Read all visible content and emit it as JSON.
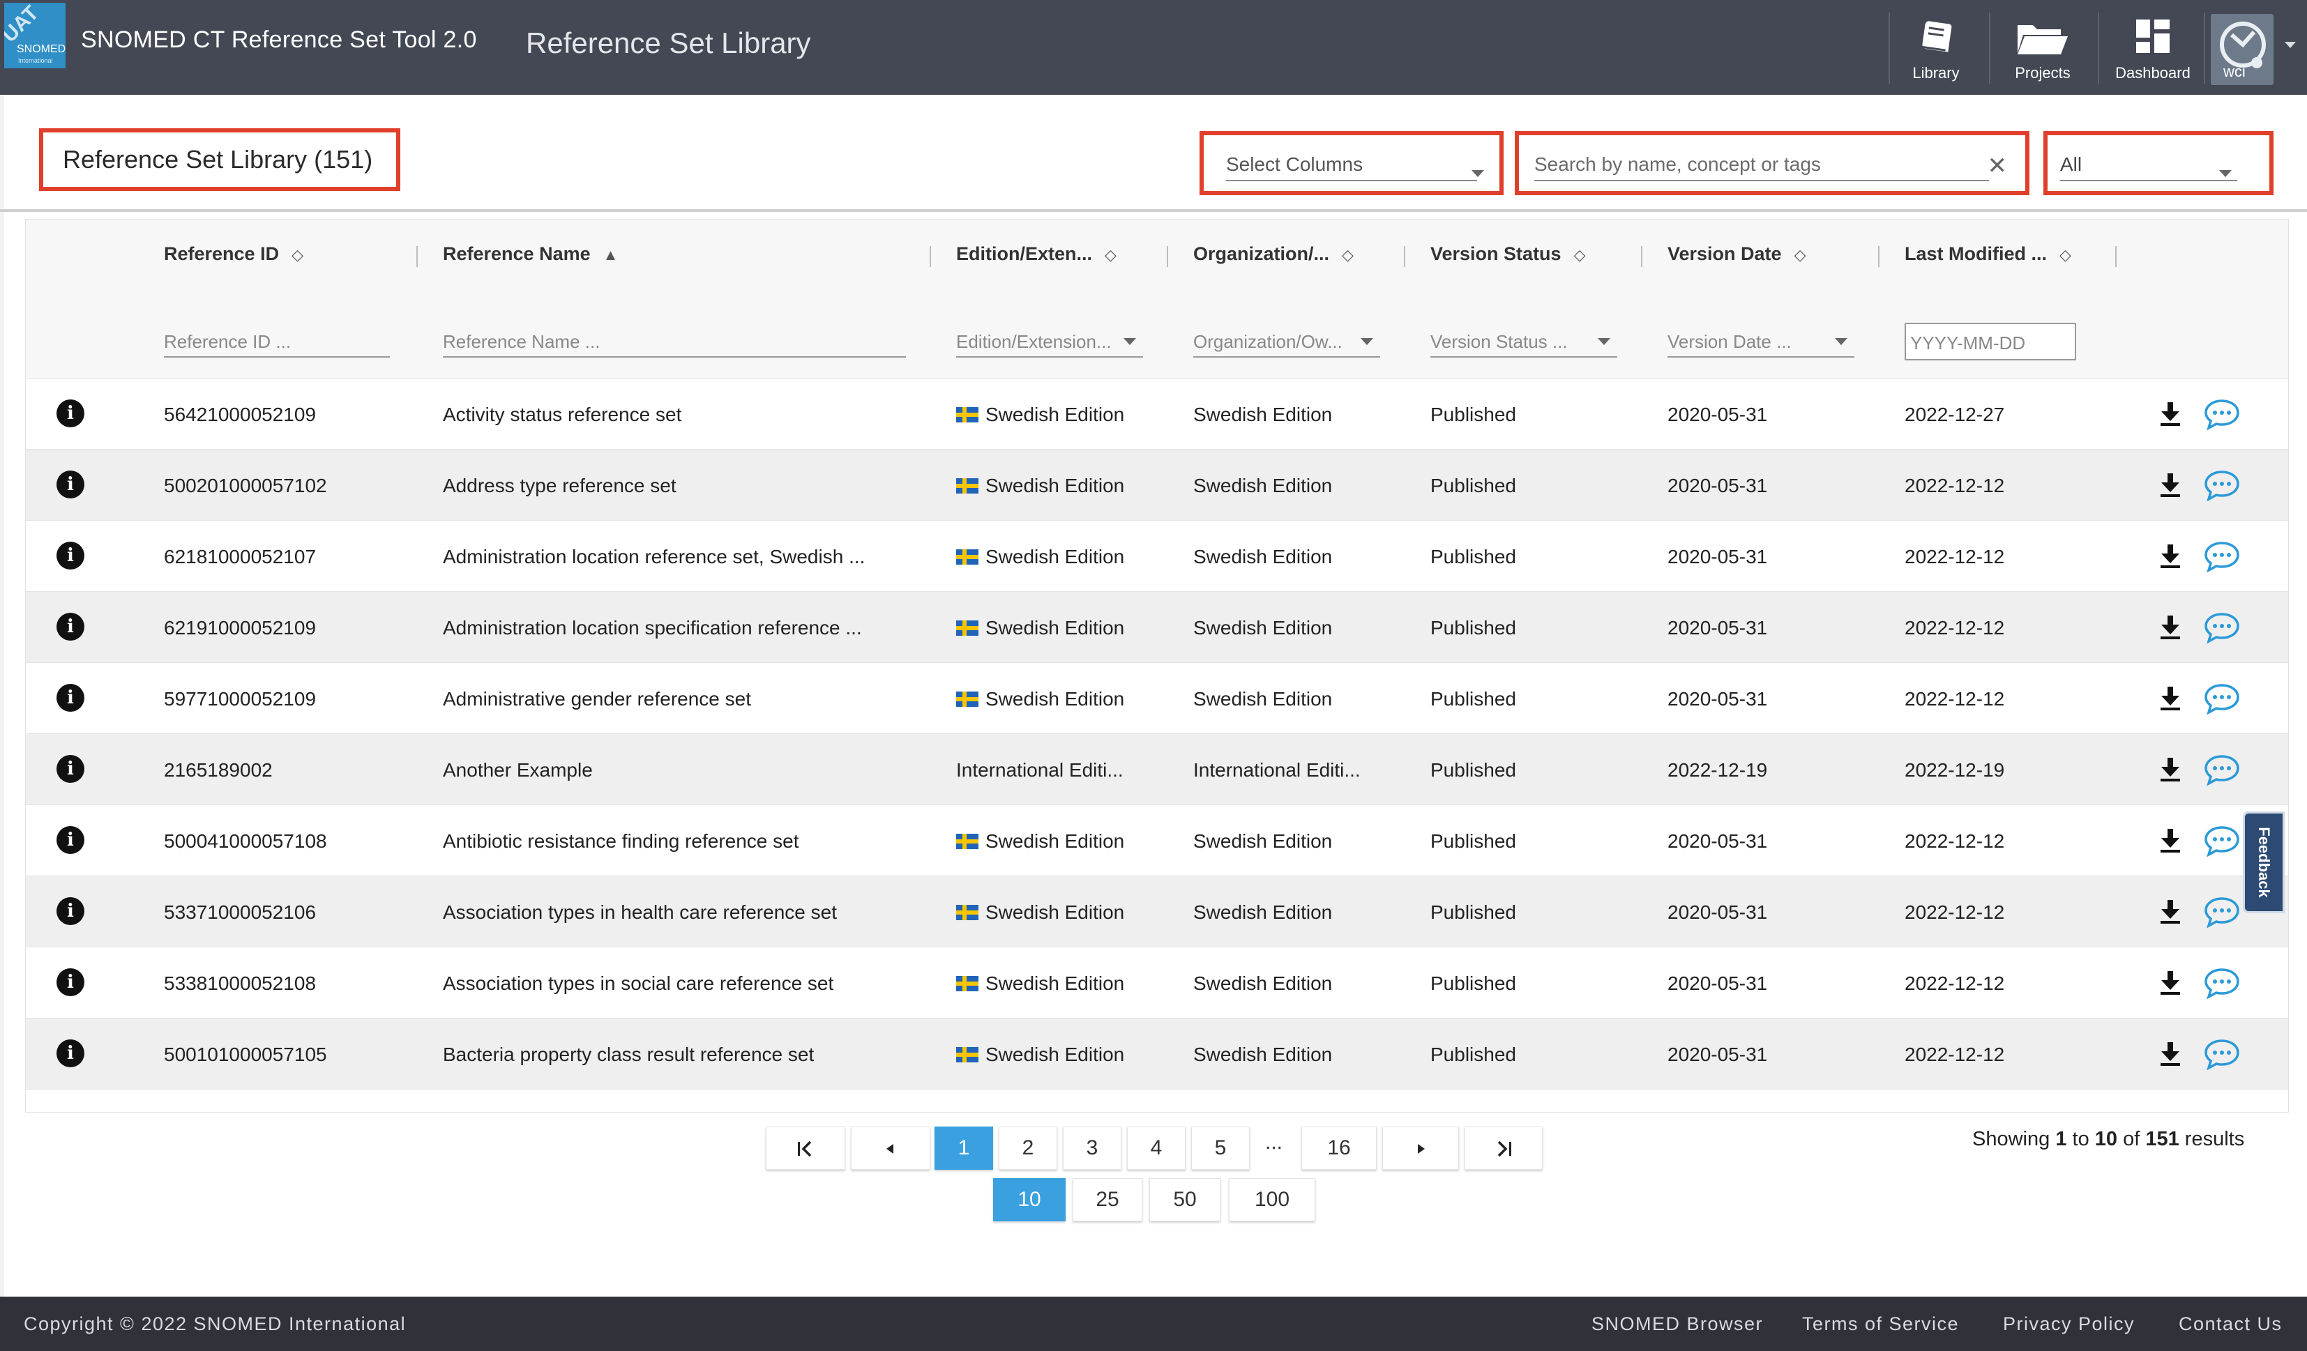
{
  "header": {
    "logo_uat": "UAT",
    "logo_brand": "SNOMED",
    "logo_sub": "International",
    "app_title": "SNOMED CT Reference Set Tool 2.0",
    "page_heading": "Reference Set Library",
    "nav": [
      {
        "label": "Library",
        "icon": "book-icon"
      },
      {
        "label": "Projects",
        "icon": "folder-icon"
      },
      {
        "label": "Dashboard",
        "icon": "dashboard-icon"
      }
    ],
    "user_initials": "wci"
  },
  "toolbar": {
    "library_title": "Reference Set Library (151)",
    "select_columns": "Select Columns",
    "search_placeholder": "Search by name, concept or tags",
    "scope_value": "All"
  },
  "table": {
    "columns": [
      {
        "label": "Reference ID",
        "sort": "both"
      },
      {
        "label": "Reference Name",
        "sort": "asc"
      },
      {
        "label": "Edition/Exten...",
        "sort": "both"
      },
      {
        "label": "Organization/...",
        "sort": "both"
      },
      {
        "label": "Version Status",
        "sort": "both"
      },
      {
        "label": "Version Date",
        "sort": "both"
      },
      {
        "label": "Last Modified ...",
        "sort": "both"
      }
    ],
    "filters": {
      "reference_id": "Reference ID ...",
      "reference_name": "Reference Name ...",
      "edition": "Edition/Extension...",
      "organization": "Organization/Ow...",
      "version_status": "Version Status ...",
      "version_date": "Version Date ...",
      "last_modified": "YYYY-MM-DD"
    },
    "rows": [
      {
        "id": "56421000052109",
        "name": "Activity status reference set",
        "edition": "Swedish Edition",
        "flag": true,
        "org": "Swedish Edition",
        "status": "Published",
        "version_date": "2020-05-31",
        "modified": "2022-12-27"
      },
      {
        "id": "500201000057102",
        "name": "Address type reference set",
        "edition": "Swedish Edition",
        "flag": true,
        "org": "Swedish Edition",
        "status": "Published",
        "version_date": "2020-05-31",
        "modified": "2022-12-12"
      },
      {
        "id": "62181000052107",
        "name": "Administration location reference set, Swedish ...",
        "edition": "Swedish Edition",
        "flag": true,
        "org": "Swedish Edition",
        "status": "Published",
        "version_date": "2020-05-31",
        "modified": "2022-12-12"
      },
      {
        "id": "62191000052109",
        "name": "Administration location specification reference ...",
        "edition": "Swedish Edition",
        "flag": true,
        "org": "Swedish Edition",
        "status": "Published",
        "version_date": "2020-05-31",
        "modified": "2022-12-12"
      },
      {
        "id": "59771000052109",
        "name": "Administrative gender reference set",
        "edition": "Swedish Edition",
        "flag": true,
        "org": "Swedish Edition",
        "status": "Published",
        "version_date": "2020-05-31",
        "modified": "2022-12-12"
      },
      {
        "id": "2165189002",
        "name": "Another Example",
        "edition": "International Editi...",
        "flag": false,
        "org": "International Editi...",
        "status": "Published",
        "version_date": "2022-12-19",
        "modified": "2022-12-19"
      },
      {
        "id": "500041000057108",
        "name": "Antibiotic resistance finding reference set",
        "edition": "Swedish Edition",
        "flag": true,
        "org": "Swedish Edition",
        "status": "Published",
        "version_date": "2020-05-31",
        "modified": "2022-12-12"
      },
      {
        "id": "53371000052106",
        "name": "Association types in health care reference set",
        "edition": "Swedish Edition",
        "flag": true,
        "org": "Swedish Edition",
        "status": "Published",
        "version_date": "2020-05-31",
        "modified": "2022-12-12"
      },
      {
        "id": "53381000052108",
        "name": "Association types in social care reference set",
        "edition": "Swedish Edition",
        "flag": true,
        "org": "Swedish Edition",
        "status": "Published",
        "version_date": "2020-05-31",
        "modified": "2022-12-12"
      },
      {
        "id": "500101000057105",
        "name": "Bacteria property class result reference set",
        "edition": "Swedish Edition",
        "flag": true,
        "org": "Swedish Edition",
        "status": "Published",
        "version_date": "2020-05-31",
        "modified": "2022-12-12"
      }
    ]
  },
  "pagination": {
    "pages": [
      "1",
      "2",
      "3",
      "4",
      "5"
    ],
    "ellipsis": "...",
    "last_page": "16",
    "current_page": "1",
    "page_sizes": [
      "10",
      "25",
      "50",
      "100"
    ],
    "current_size": "10",
    "showing_prefix": "Showing",
    "showing_from": "1",
    "showing_to_word": "to",
    "showing_to": "10",
    "showing_of_word": "of",
    "showing_total": "151",
    "showing_suffix": "results"
  },
  "feedback_label": "Feedback",
  "footer": {
    "copyright": "Copyright © 2022 SNOMED International",
    "links": [
      "SNOMED Browser",
      "Terms of Service",
      "Privacy Policy",
      "Contact Us"
    ]
  },
  "colors": {
    "header_bg": "#434854",
    "highlight_box": "#e0402b",
    "active_page": "#3aa0e0",
    "chat_icon": "#2b9ad8",
    "footer_bg": "#2f3238"
  }
}
